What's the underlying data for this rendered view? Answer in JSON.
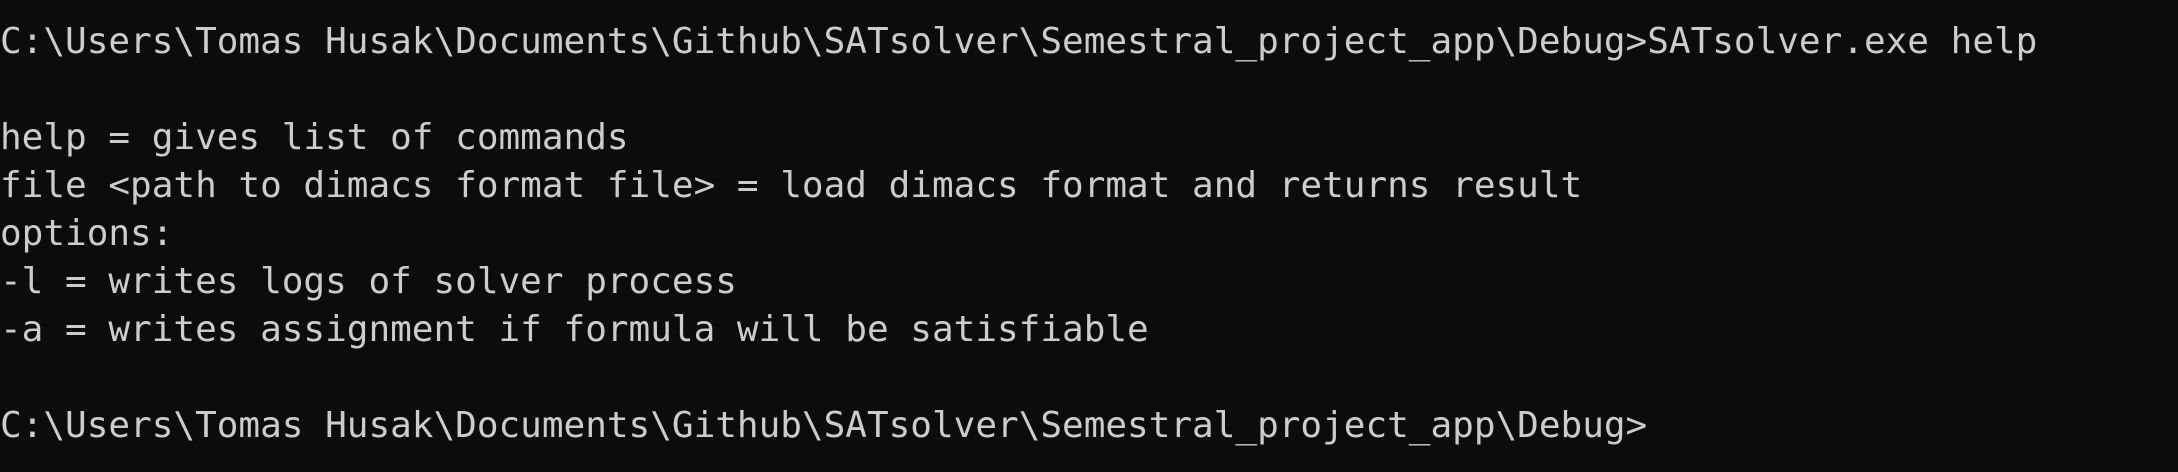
{
  "console": {
    "prompt1": {
      "path": "C:\\Users\\Tomas Husak\\Documents\\Github\\SATsolver\\Semestral_project_app\\Debug>",
      "command": "SATsolver.exe help"
    },
    "output": [
      "help = gives list of commands",
      "file <path to dimacs format file> = load dimacs format and returns result",
      "options:",
      "-l = writes logs of solver process",
      "-a = writes assignment if formula will be satisfiable"
    ],
    "prompt2": {
      "path": "C:\\Users\\Tomas Husak\\Documents\\Github\\SATsolver\\Semestral_project_app\\Debug>"
    }
  }
}
